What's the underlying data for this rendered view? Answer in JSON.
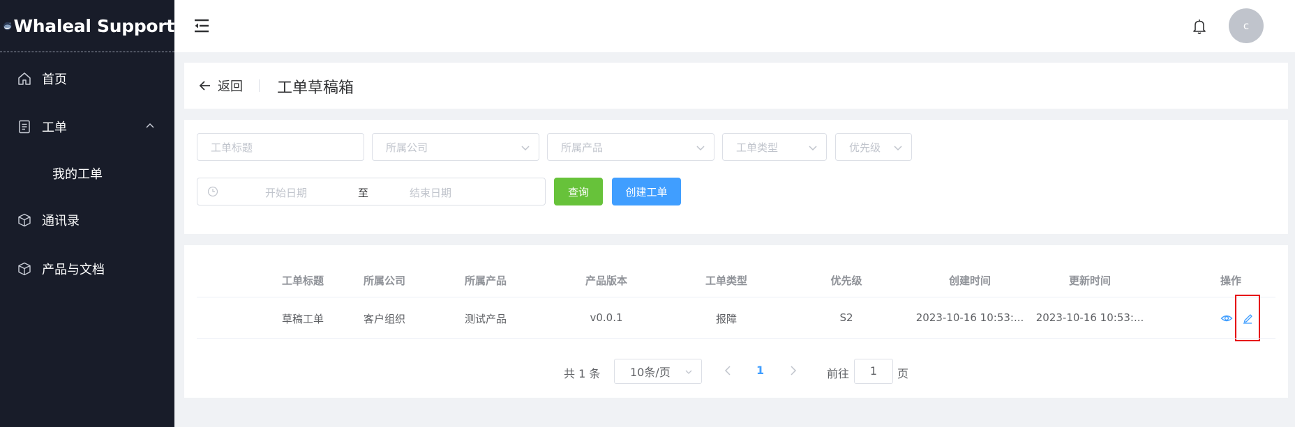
{
  "app": {
    "title": "Whaleal Support"
  },
  "sidebar": {
    "items": [
      {
        "label": "首页",
        "icon": "home-icon"
      },
      {
        "label": "工单",
        "icon": "document-icon"
      },
      {
        "label": "我的工单"
      },
      {
        "label": "通讯录",
        "icon": "box-icon"
      },
      {
        "label": "产品与文档",
        "icon": "box-icon"
      }
    ]
  },
  "header": {
    "avatar_initial": "c"
  },
  "page": {
    "back_label": "返回",
    "title": "工单草稿箱"
  },
  "filters": {
    "title_placeholder": "工单标题",
    "company_placeholder": "所属公司",
    "product_placeholder": "所属产品",
    "type_placeholder": "工单类型",
    "priority_placeholder": "优先级",
    "start_date_placeholder": "开始日期",
    "range_separator": "至",
    "end_date_placeholder": "结束日期",
    "query_label": "查询",
    "create_label": "创建工单"
  },
  "table": {
    "columns": [
      "工单标题",
      "所属公司",
      "所属产品",
      "产品版本",
      "工单类型",
      "优先级",
      "创建时间",
      "更新时间",
      "操作"
    ],
    "rows": [
      [
        "草稿工单",
        "客户组织",
        "测试产品",
        "v0.0.1",
        "报障",
        "S2",
        "2023-10-16 10:53:...",
        "2023-10-16 10:53:..."
      ]
    ]
  },
  "pagination": {
    "total_text": "共 1 条",
    "page_size": "10条/页",
    "current_page": "1",
    "goto_label": "前往",
    "goto_value": "1",
    "page_suffix": "页"
  },
  "colors": {
    "sidebar_bg": "#181c29",
    "primary": "#409eff",
    "success": "#67c23a",
    "highlight": "#e60012"
  }
}
